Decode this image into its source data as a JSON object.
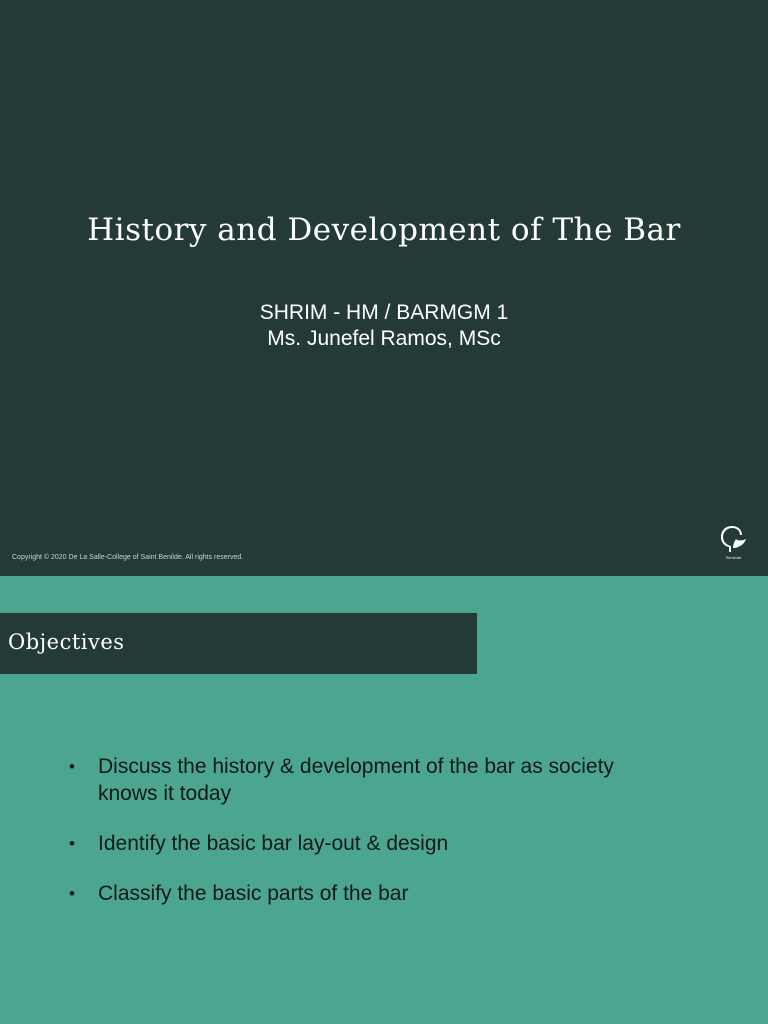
{
  "slide1": {
    "title": "History and Development of The Bar",
    "subtitle_line1": "SHRIM - HM / BARMGM 1",
    "subtitle_line2": "Ms. Junefel Ramos, MSc",
    "copyright": "Copyright © 2020 De La Salle-College of Saint Benilde. All rights reserved.",
    "logo_text": "Benilde",
    "logo_icon": "benilde-logo-icon"
  },
  "slide2": {
    "heading": "Objectives",
    "bullets": [
      "Discuss the history & development of the bar as society knows it today",
      "Identify the basic bar lay-out & design",
      "Classify the basic parts of the bar"
    ]
  },
  "colors": {
    "dark_green": "#233a37",
    "teal": "#4ca58f",
    "white": "#ffffff"
  }
}
